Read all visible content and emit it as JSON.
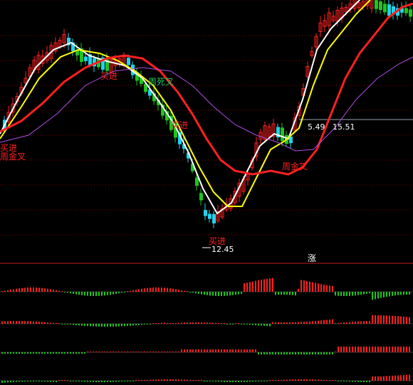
{
  "colors": {
    "background": "#000000",
    "grid": "#8b0000",
    "up": "#ff2020",
    "down_bar": "#22d3ee",
    "down_bar_alt": "#1ec51e",
    "ma_fast": "#ffffff",
    "ma_mid": "#ffff00",
    "ma_slow": "#ff2020",
    "ma_long": "#b14ee0",
    "label_red": "#ff2020",
    "label_text": "#ffffff",
    "divider": "#c81e1e"
  },
  "chart_data": {
    "type": "candlestick",
    "price_min": 12.45,
    "price_max_marked": 15.51,
    "annotations": {
      "low_price": "12.45",
      "mid_level": "5.49",
      "high_level": "15.51",
      "buy_labels": [
        "买进",
        "买进",
        "买进",
        "买进"
      ],
      "cross_labels": [
        "周金叉",
        "周死叉",
        "周金叉"
      ],
      "rise_marker": "涨"
    },
    "indicator_rows": 4,
    "grid": true
  }
}
